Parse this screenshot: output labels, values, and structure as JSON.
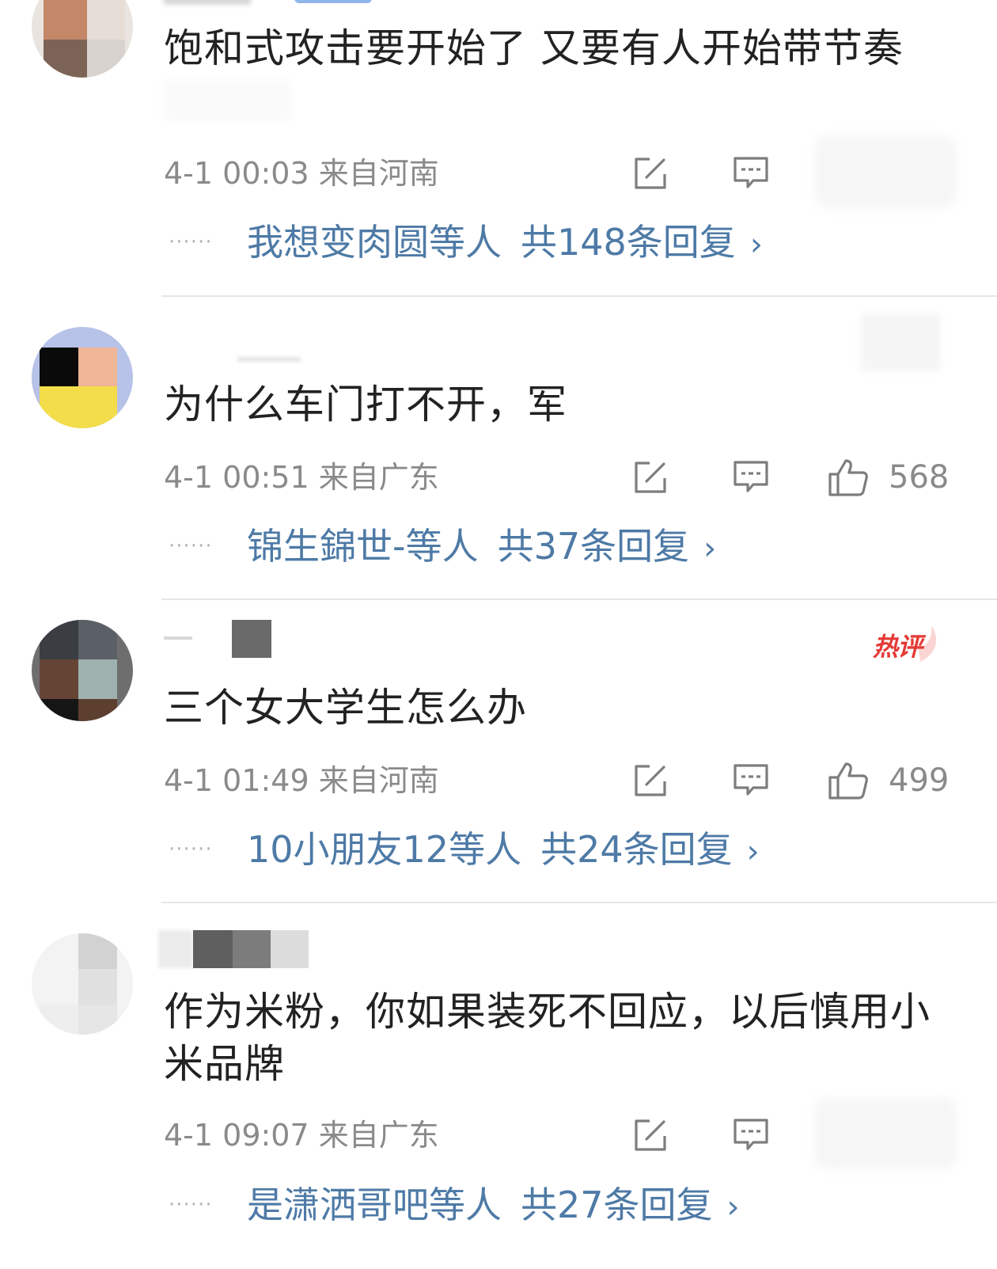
{
  "comments": [
    {
      "text": "饱和式攻击要开始了 又要有人开始带节奏",
      "time_location": "4-1 00:03  来自河南",
      "like_count": "",
      "hot_badge": "",
      "replies": {
        "dots": "······",
        "names": "我想变肉圆等人",
        "total": "共148条回复",
        "chevron": "›"
      }
    },
    {
      "text": "为什么车门打不开，军",
      "time_location": "4-1 00:51  来自广东",
      "like_count": "568",
      "hot_badge": "",
      "replies": {
        "dots": "······",
        "names": "锦生錦世-等人",
        "total": "共37条回复",
        "chevron": "›"
      }
    },
    {
      "text": "三个女大学生怎么办",
      "time_location": "4-1 01:49  来自河南",
      "like_count": "499",
      "hot_badge": "热评",
      "replies": {
        "dots": "······",
        "names": "10小朋友12等人",
        "total": "共24条回复",
        "chevron": "›"
      }
    },
    {
      "text": "作为米粉，你如果装死不回应，以后慎用小米品牌",
      "time_location": "4-1 09:07  来自广东",
      "like_count": "",
      "hot_badge": "",
      "replies": {
        "dots": "······",
        "names": "是潇洒哥吧等人",
        "total": "共27条回复",
        "chevron": "›"
      }
    }
  ],
  "icons": {
    "share": "share-icon",
    "reply": "comment-icon",
    "like": "thumbs-up-icon"
  },
  "colors": {
    "link": "#4e7aa6",
    "meta": "#8a8a8a",
    "hot": "#e53935",
    "divider": "#e6e6e6"
  }
}
